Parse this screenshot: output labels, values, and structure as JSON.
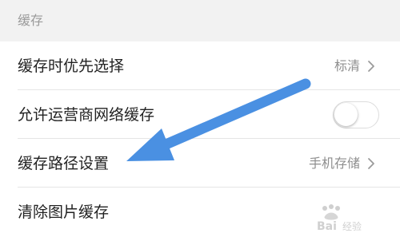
{
  "section": {
    "title": "缓存"
  },
  "rows": [
    {
      "label": "缓存时优先选择",
      "value": "标清"
    },
    {
      "label": "允许运营商网络缓存",
      "toggle_on": false
    },
    {
      "label": "缓存路径设置",
      "value": "手机存储"
    },
    {
      "label": "清除图片缓存"
    }
  ],
  "overlay": {
    "arrow_color": "#4a90e2"
  },
  "watermark": {
    "text": "Baidu 经验"
  }
}
